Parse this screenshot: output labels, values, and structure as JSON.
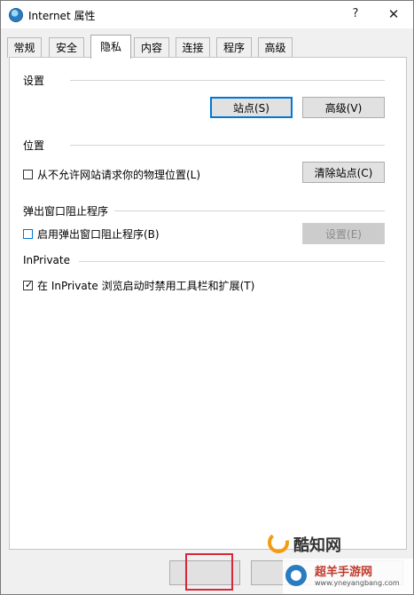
{
  "window": {
    "title": "Internet 属性",
    "help_glyph": "?",
    "close_glyph": "✕"
  },
  "tabs": [
    {
      "label": "常规",
      "active": false
    },
    {
      "label": "安全",
      "active": false
    },
    {
      "label": "隐私",
      "active": true
    },
    {
      "label": "内容",
      "active": false
    },
    {
      "label": "连接",
      "active": false
    },
    {
      "label": "程序",
      "active": false
    },
    {
      "label": "高级",
      "active": false
    }
  ],
  "settings": {
    "heading": "设置",
    "sites_button": "站点(S)",
    "advanced_button": "高级(V)"
  },
  "location": {
    "heading": "位置",
    "checkbox_label": "从不允许网站请求你的物理位置(L)",
    "checkbox_checked": false,
    "clear_sites_button": "清除站点(C)"
  },
  "popup_blocker": {
    "heading": "弹出窗口阻止程序",
    "checkbox_label": "启用弹出窗口阻止程序(B)",
    "checkbox_checked": false,
    "settings_button": "设置(E)"
  },
  "inprivate": {
    "heading": "InPrivate",
    "checkbox_label": "在 InPrivate 浏览启动时禁用工具栏和扩展(T)",
    "checkbox_checked": true
  },
  "footer": {
    "watermark_text": "酷知网",
    "watermark_text_2": "超羊手游网",
    "watermark_url": "www.yneyangbang.com"
  },
  "colors": {
    "accent": "#0078d7",
    "highlight_box": "#d9263a",
    "watermark_orange": "#f39c12"
  }
}
